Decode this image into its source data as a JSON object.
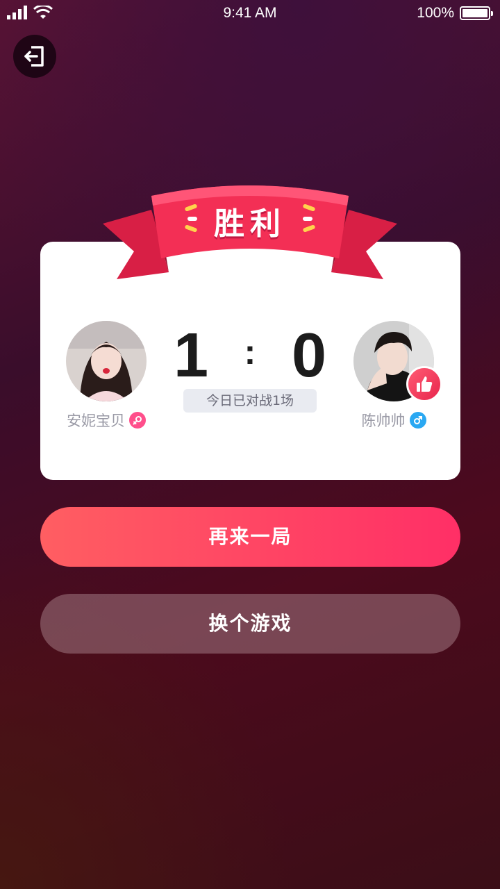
{
  "status_bar": {
    "time": "9:41 AM",
    "battery": "100%"
  },
  "result": {
    "title": "胜利"
  },
  "players": {
    "left": {
      "name": "安妮宝贝",
      "gender": "female"
    },
    "right": {
      "name": "陈帅帅",
      "gender": "male"
    }
  },
  "score": {
    "left": "1",
    "separator": ":",
    "right": "0",
    "matches_today": "今日已对战1场"
  },
  "actions": {
    "play_again": "再来一局",
    "switch_game": "换个游戏"
  },
  "colors": {
    "accent": "#ff2f66",
    "ribbon": "#f0294f",
    "female": "#ff4f8b",
    "male": "#2aa8f2"
  }
}
